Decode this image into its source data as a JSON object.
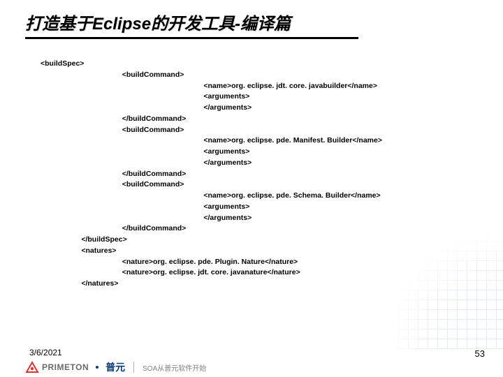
{
  "title": "打造基于Eclipse的开发工具-编译篇",
  "code": {
    "lines": [
      {
        "indent": 0,
        "text": "<buildSpec>"
      },
      {
        "indent": 2,
        "text": "<buildCommand>"
      },
      {
        "indent": 4,
        "text": "<name>org. eclipse. jdt. core. javabuilder</name>"
      },
      {
        "indent": 4,
        "text": "<arguments>"
      },
      {
        "indent": 4,
        "text": "</arguments>"
      },
      {
        "indent": 2,
        "text": "</buildCommand>"
      },
      {
        "indent": 2,
        "text": "<buildCommand>"
      },
      {
        "indent": 4,
        "text": "<name>org. eclipse. pde. Manifest. Builder</name>"
      },
      {
        "indent": 4,
        "text": "<arguments>"
      },
      {
        "indent": 4,
        "text": "</arguments>"
      },
      {
        "indent": 2,
        "text": "</buildCommand>"
      },
      {
        "indent": 2,
        "text": "<buildCommand>"
      },
      {
        "indent": 4,
        "text": "<name>org. eclipse. pde. Schema. Builder</name>"
      },
      {
        "indent": 4,
        "text": "<arguments>"
      },
      {
        "indent": 4,
        "text": "</arguments>"
      },
      {
        "indent": 2,
        "text": "</buildCommand>"
      },
      {
        "indent": 1,
        "text": "</buildSpec>"
      },
      {
        "indent": 1,
        "text": "<natures>"
      },
      {
        "indent": 2,
        "text": "<nature>org. eclipse. pde. Plugin. Nature</nature>"
      },
      {
        "indent": 2,
        "text": "<nature>org. eclipse. jdt. core. javanature</nature>"
      },
      {
        "indent": 1,
        "text": "</natures>"
      }
    ]
  },
  "footer": {
    "date": "3/6/2021",
    "page_number": "53",
    "logo_text": "PRIMETON",
    "cjk_logo": "普元",
    "tagline": "SOA从普元软件开始"
  }
}
